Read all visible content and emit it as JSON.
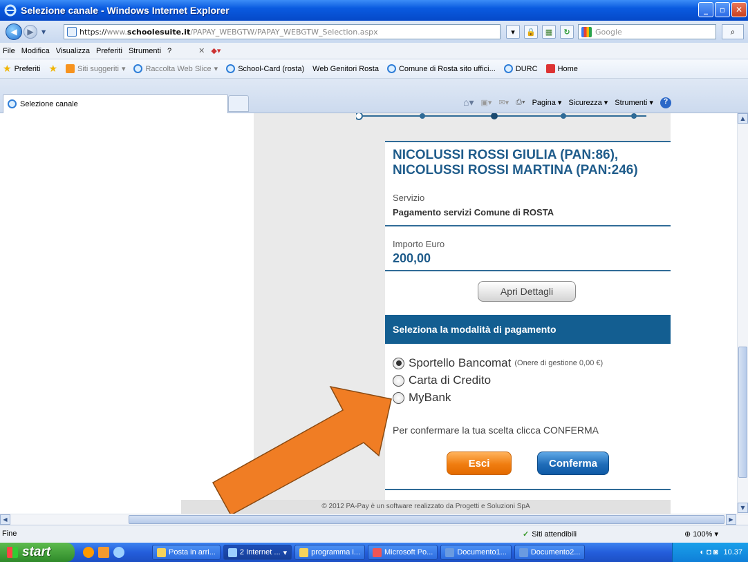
{
  "window": {
    "title": "Selezione canale - Windows Internet Explorer"
  },
  "address": {
    "scheme": "https://",
    "host_prefix": "www.",
    "host": "schoolesuite.it",
    "path": "/PAPAY_WEBGTW/PAPAY_WEBGTW_Selection.aspx",
    "search_placeholder": "Google"
  },
  "menu": [
    "File",
    "Modifica",
    "Visualizza",
    "Preferiti",
    "Strumenti",
    "?"
  ],
  "favorites": {
    "label": "Preferiti",
    "items": [
      {
        "label": "Siti suggeriti",
        "gray": true
      },
      {
        "label": "Raccolta Web Slice",
        "gray": true
      },
      {
        "label": "School-Card (rosta)"
      },
      {
        "label": "Web Genitori Rosta"
      },
      {
        "label": "Comune di Rosta sito uffici..."
      },
      {
        "label": "DURC"
      },
      {
        "label": "Home"
      }
    ]
  },
  "tab": {
    "label": "Selezione canale"
  },
  "command_bar": {
    "page": "Pagina",
    "safety": "Sicurezza",
    "tools": "Strumenti"
  },
  "payment": {
    "students": "NICOLUSSI ROSSI GIULIA (PAN:86), NICOLUSSI ROSSI MARTINA (PAN:246)",
    "service_label": "Servizio",
    "service_value": "Pagamento servizi Comune di ROSTA",
    "amount_label": "Importo Euro",
    "amount_value": "200,00",
    "details_button": "Apri Dettagli",
    "method_header": "Seleziona la modalità di pagamento",
    "options": [
      {
        "label": "Sportello Bancomat",
        "note": "(Onere di gestione 0,00 €)",
        "selected": true
      },
      {
        "label": "Carta di Credito",
        "note": "",
        "selected": false
      },
      {
        "label": "MyBank",
        "note": "",
        "selected": false
      }
    ],
    "confirm_text": "Per confermare la tua scelta clicca CONFERMA",
    "exit_button": "Esci",
    "confirm_button": "Conferma",
    "footer": "© 2012 PA-Pay è un software realizzato da Progetti e Soluzioni SpA"
  },
  "annotation": {
    "color": "#f07d24"
  },
  "status": {
    "left": "Fine",
    "zone": "Siti attendibili",
    "zoom": "100%"
  },
  "taskbar": {
    "start": "start",
    "tasks": [
      "Posta in arri...",
      "2 Internet ...",
      "programma i...",
      "Microsoft Po...",
      "Documento1...",
      "Documento2..."
    ],
    "clock": "10.37"
  }
}
